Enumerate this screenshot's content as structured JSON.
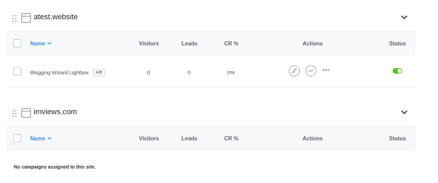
{
  "sites": [
    {
      "title": "atest.website",
      "columns": {
        "name": "Name",
        "visitors": "Visitors",
        "leads": "Leads",
        "cr": "CR %",
        "actions": "Actions",
        "status": "Status"
      },
      "rows": [
        {
          "name": "Blogging Wizard Lightbox",
          "badge": "A/B",
          "visitors": "0",
          "leads": "0",
          "cr": "0%",
          "more": "•••",
          "status_enabled": true
        }
      ]
    },
    {
      "title": "imviews.com",
      "columns": {
        "name": "Name",
        "visitors": "Visitors",
        "leads": "Leads",
        "cr": "CR %",
        "actions": "Actions",
        "status": "Status"
      },
      "rows": [],
      "empty_message": "No campaigns assigned to this site."
    }
  ],
  "colors": {
    "accent": "#3a8edb",
    "toggle_on": "#52c41a",
    "header_bg": "#f6f8fa"
  },
  "icons": [
    "drag-handle-icon",
    "browser-window-icon",
    "chevron-down-icon",
    "edit-pencil-icon",
    "stats-trend-icon",
    "more-options-icon",
    "toggle-switch"
  ]
}
